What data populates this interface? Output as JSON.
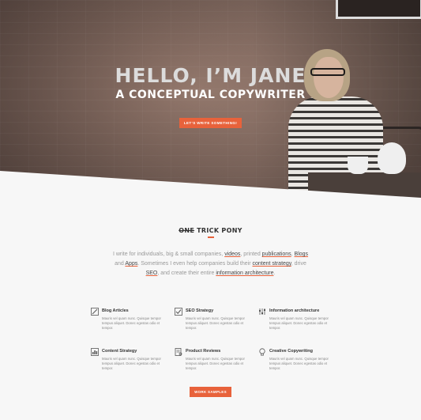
{
  "hero": {
    "title": "HELLO, I’M JANE",
    "subtitle": "A CONCEPTUAL COPYWRITER",
    "cta_label": "LET’S WRITE SOMETHING!"
  },
  "section": {
    "title_strike": "ONE",
    "title_rest": " TRICK PONY",
    "intro": {
      "p1": "I write for individuals, big & small companies, ",
      "l1": "videos",
      "p2": ", printed ",
      "l2": "publications",
      "p3": ", ",
      "l3": "Blogs",
      "p4": " and ",
      "l4": "Apps",
      "p5": ". Sometimes I even help companies build their ",
      "l5": "content strategy",
      "p6": ", drive ",
      "l6": "SEO",
      "p7": ", and create their entire ",
      "l7": "information architecture",
      "p8": "."
    }
  },
  "features": [
    {
      "icon": "pencil-icon",
      "title": "Blog Articles",
      "desc": "Mauris vel quam nunc. Quisque tempor tempus aliquet. Donec egestas odio et tempor."
    },
    {
      "icon": "checkbox-icon",
      "title": "SEO Strategy",
      "desc": "Mauris vel quam nunc. Quisque tempor tempus aliquet. Donec egestas odio et tempor."
    },
    {
      "icon": "sliders-icon",
      "title": "Information architecture",
      "desc": "Mauris vel quam nunc. Quisque tempor tempus aliquet. Donec egestas odio et tempor."
    },
    {
      "icon": "chart-icon",
      "title": "Content Strategy",
      "desc": "Mauris vel quam nunc. Quisque tempor tempus aliquet. Donec egestas odio et tempor."
    },
    {
      "icon": "review-icon",
      "title": "Product Reviews",
      "desc": "Mauris vel quam nunc. Quisque tempor tempus aliquet. Donec egestas odio et tempor."
    },
    {
      "icon": "lightbulb-icon",
      "title": "Creative Copywriting",
      "desc": "Mauris vel quam nunc. Quisque tempor tempus aliquet. Donec egestas odio et tempor."
    }
  ],
  "work_button_label": "WORK SAMPLES",
  "colors": {
    "accent": "#e8623b",
    "background": "#f7f7f7"
  }
}
